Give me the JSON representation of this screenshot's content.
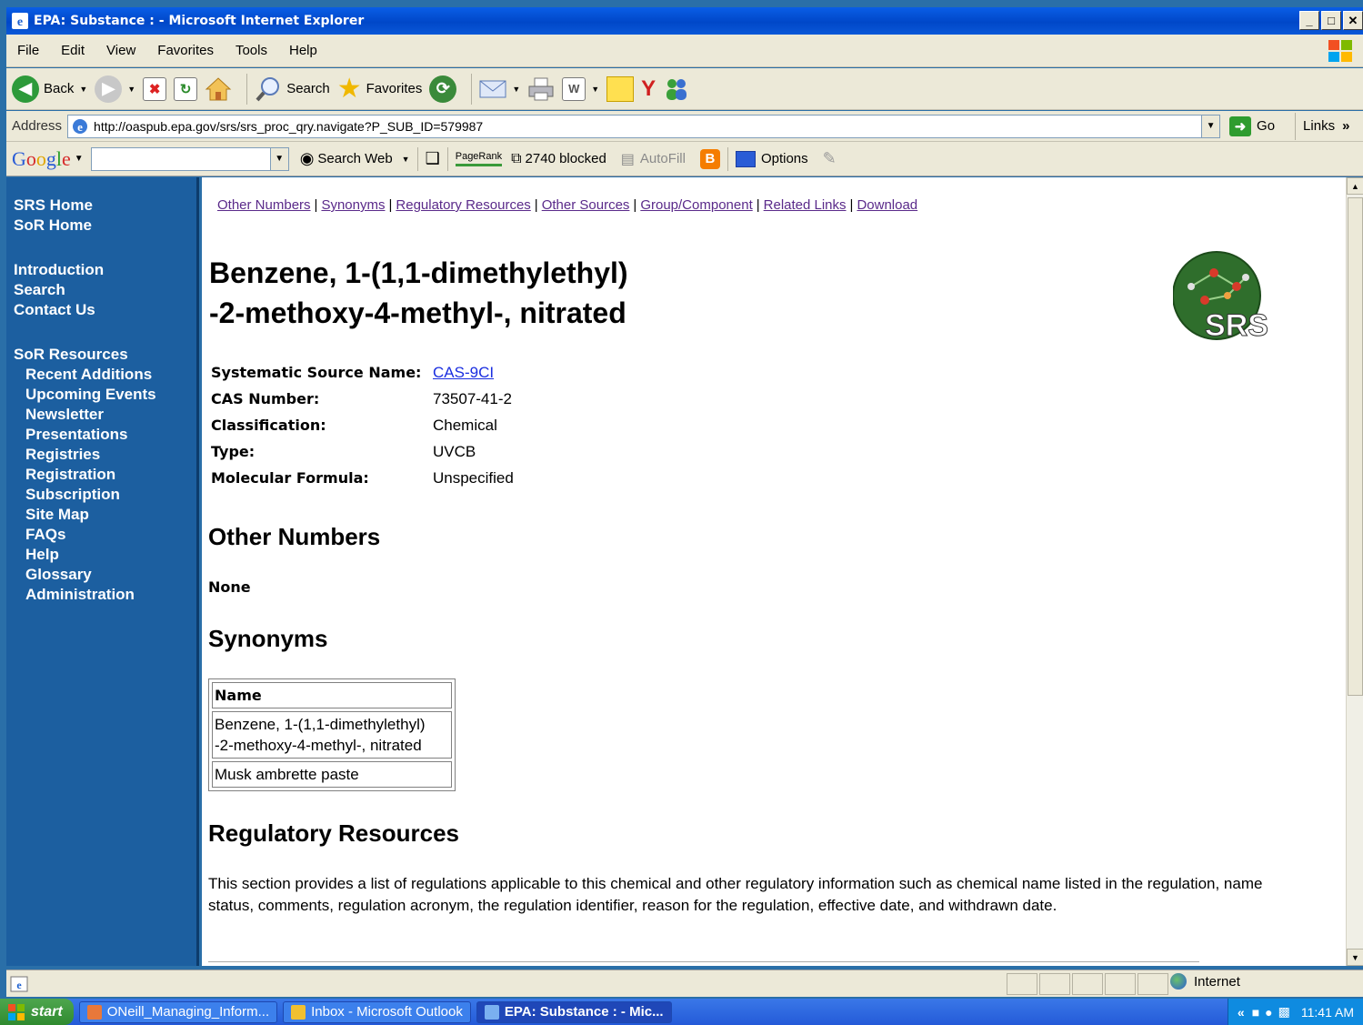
{
  "window": {
    "title": "EPA: Substance : - Microsoft Internet Explorer",
    "controls": [
      "_",
      "□",
      "✕"
    ]
  },
  "menu": [
    "File",
    "Edit",
    "View",
    "Favorites",
    "Tools",
    "Help"
  ],
  "toolbar": {
    "back": "Back",
    "search": "Search",
    "favorites": "Favorites"
  },
  "address": {
    "label": "Address",
    "url": "http://oaspub.epa.gov/srs/srs_proc_qry.navigate?P_SUB_ID=579987",
    "go": "Go",
    "links": "Links",
    "links_chevron": "»"
  },
  "googlebar": {
    "logo": [
      "G",
      "o",
      "o",
      "g",
      "l",
      "e"
    ],
    "search_web": "Search Web",
    "pagerank": "PageRank",
    "blocked": "2740 blocked",
    "autofill": "AutoFill",
    "options": "Options"
  },
  "sidebar": {
    "group1": [
      "SRS Home",
      "SoR Home"
    ],
    "group2": [
      "Introduction",
      "Search",
      "Contact Us"
    ],
    "resources_title": "SoR Resources",
    "resources": [
      "Recent Additions",
      "Upcoming Events",
      "Newsletter",
      "Presentations",
      "Registries",
      "Registration",
      "Subscription",
      "Site Map",
      "FAQs",
      "Help",
      "Glossary",
      "Administration"
    ]
  },
  "tabs": [
    "Other Numbers",
    "Synonyms",
    "Regulatory Resources",
    "Other Sources",
    "Group/Component",
    "Related Links",
    "Download"
  ],
  "substance": {
    "title_line1": "Benzene, 1-(1,1-dimethylethyl)",
    "title_line2": "-2-methoxy-4-methyl-, nitrated",
    "logo_text": "SRS",
    "properties": [
      {
        "label": "Systematic Source Name:",
        "value": "CAS-9CI",
        "link": true
      },
      {
        "label": "CAS Number:",
        "value": "73507-41-2",
        "link": false
      },
      {
        "label": "Classification:",
        "value": "Chemical",
        "link": false
      },
      {
        "label": "Type:",
        "value": "UVCB",
        "link": false
      },
      {
        "label": "Molecular Formula:",
        "value": "Unspecified",
        "link": false
      }
    ]
  },
  "other_numbers": {
    "heading": "Other Numbers",
    "value": "None"
  },
  "synonyms": {
    "heading": "Synonyms",
    "column": "Name",
    "rows": [
      {
        "line1": "Benzene, 1-(1,1-dimethylethyl)",
        "line2": "-2-methoxy-4-methyl-, nitrated"
      },
      {
        "line1": "Musk ambrette paste",
        "line2": ""
      }
    ]
  },
  "regulatory": {
    "heading": "Regulatory Resources",
    "text": "This section provides a list of regulations applicable to this chemical and other regulatory information such as chemical name listed in the regulation, name status, comments, regulation acronym, the regulation identifier, reason for the regulation, effective date, and withdrawn date."
  },
  "status": {
    "zone": "Internet"
  },
  "taskbar": {
    "start": "start",
    "tasks": [
      "ONeill_Managing_Inform...",
      "Inbox - Microsoft Outlook",
      "EPA: Substance : - Mic..."
    ],
    "tray_chevron": "«",
    "time": "11:41 AM"
  },
  "colors": {
    "sidebar_bg": "#1c5fa0",
    "visited_link": "#5a2a8a",
    "link": "#1a2ee0"
  }
}
